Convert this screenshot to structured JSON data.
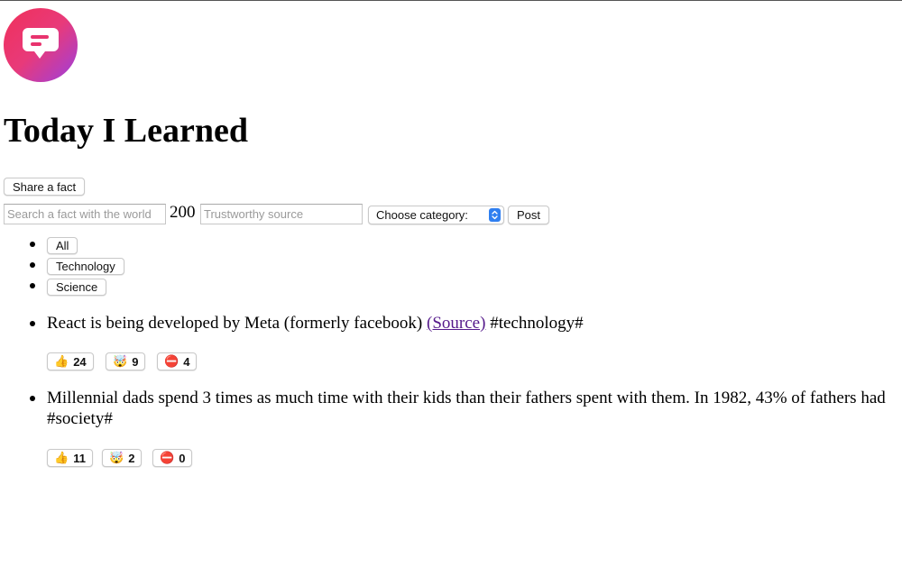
{
  "app": {
    "title": "Today I Learned",
    "logo_icon": "chat-bubble-icon",
    "logo_colors": [
      "#f0305a",
      "#9b3fe0"
    ]
  },
  "header": {
    "share_label": "Share a fact"
  },
  "form": {
    "text_placeholder": "Search a fact with the world",
    "char_count": "200",
    "source_placeholder": "Trustworthy source",
    "category_selected": "Choose category:",
    "post_label": "Post"
  },
  "categories": [
    {
      "label": "All"
    },
    {
      "label": "Technology"
    },
    {
      "label": "Science"
    }
  ],
  "facts": [
    {
      "text": "React is being developed by Meta (formerly facebook)",
      "source_label": "(Source)",
      "category": "#technology#",
      "votes": [
        {
          "icon": "👍",
          "icon_name": "thumbs-up-icon",
          "count": "24"
        },
        {
          "icon": "🤯",
          "icon_name": "mind-blown-icon",
          "count": "9"
        },
        {
          "icon": "⛔",
          "icon_name": "no-entry-icon",
          "count": "4"
        }
      ]
    },
    {
      "text": "Millennial dads spend 3 times as much time with their kids than their fathers spent with them. In 1982, 43% of fathers had",
      "source_label": "",
      "category": "#society#",
      "votes": [
        {
          "icon": "👍",
          "icon_name": "thumbs-up-icon",
          "count": "11"
        },
        {
          "icon": "🤯",
          "icon_name": "mind-blown-icon",
          "count": "2"
        },
        {
          "icon": "⛔",
          "icon_name": "no-entry-icon",
          "count": "0"
        }
      ]
    }
  ],
  "colors": {
    "link": "#551a8b",
    "select_accent": "#2f7ff0"
  }
}
